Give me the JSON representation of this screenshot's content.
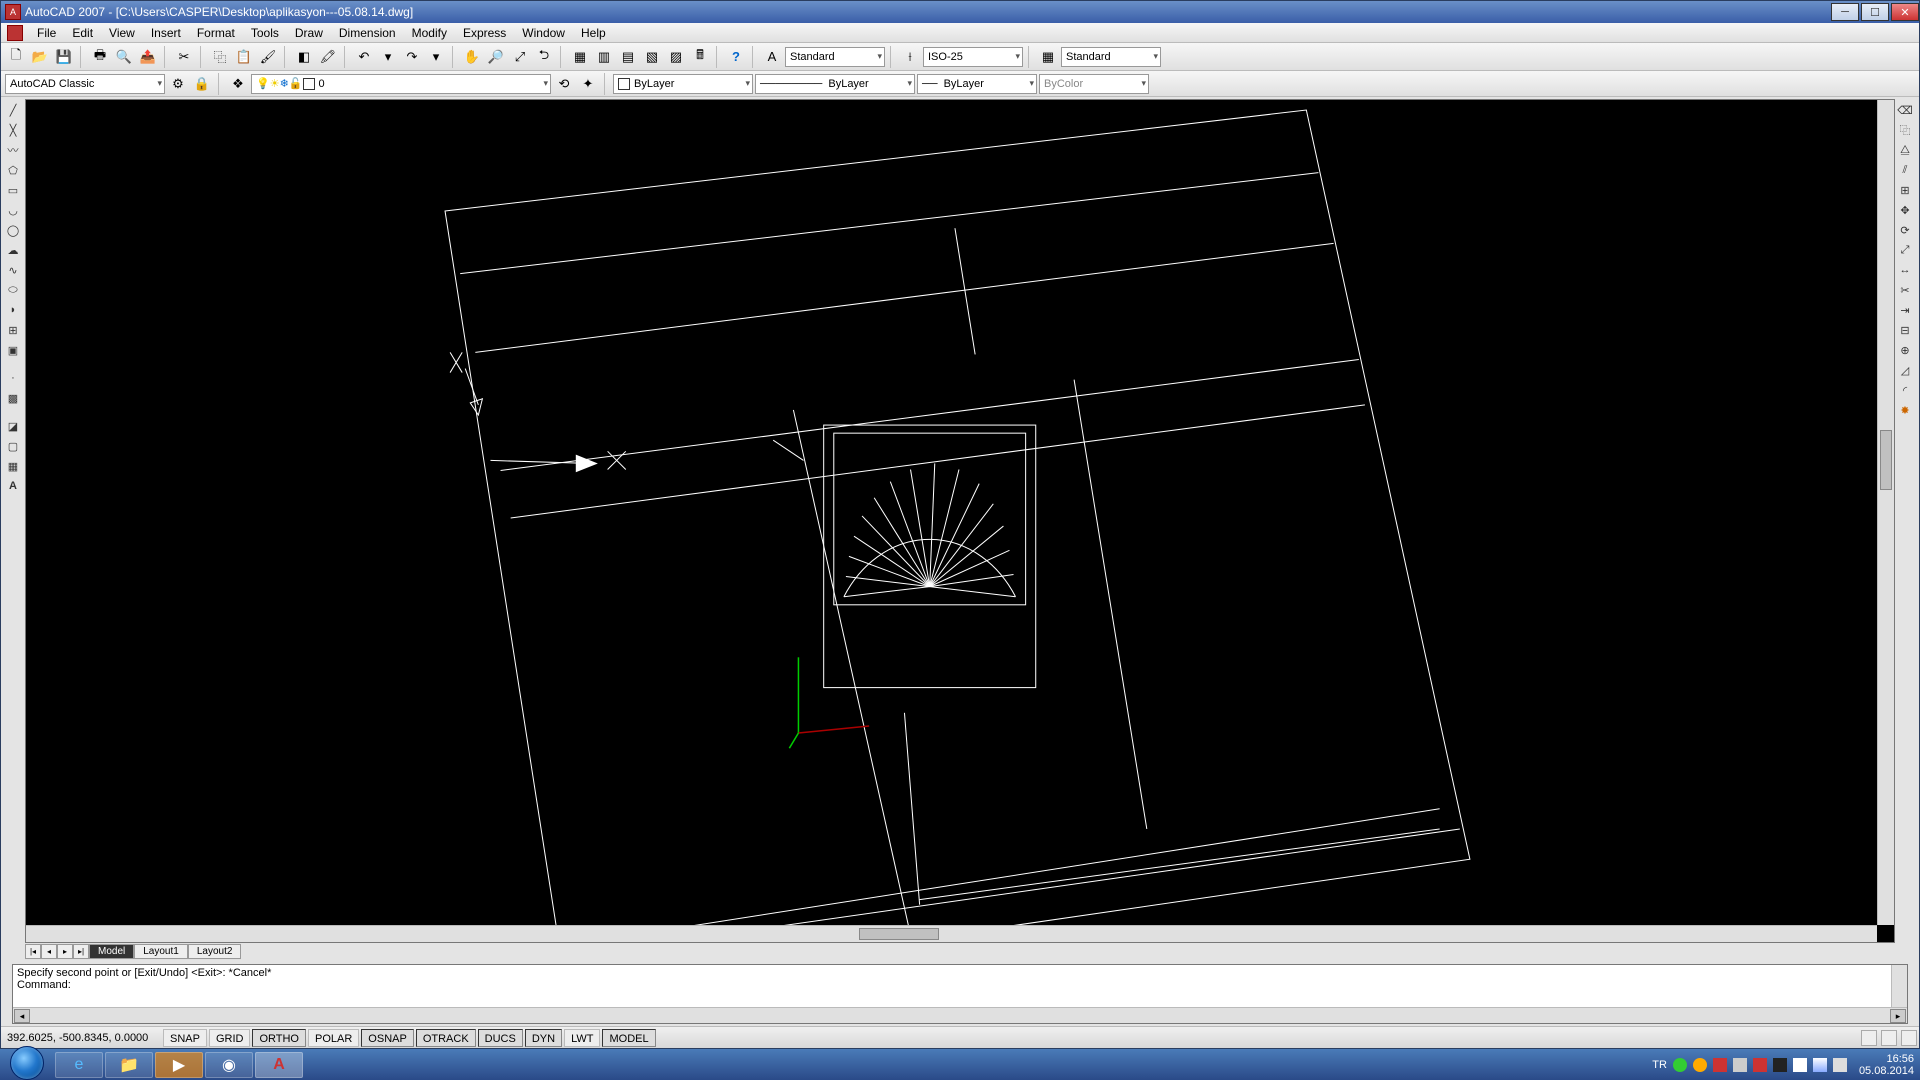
{
  "title": "AutoCAD 2007 - [C:\\Users\\CASPER\\Desktop\\aplikasyon---05.08.14.dwg]",
  "menu": [
    "File",
    "Edit",
    "View",
    "Insert",
    "Format",
    "Tools",
    "Draw",
    "Dimension",
    "Modify",
    "Express",
    "Window",
    "Help"
  ],
  "workspace": "AutoCAD Classic",
  "style1": "Standard",
  "style2": "ISO-25",
  "style3": "Standard",
  "layer": "0",
  "color": "ByLayer",
  "linetype": "ByLayer",
  "lineweight": "ByLayer",
  "plotstyle": "ByColor",
  "tabs": {
    "model": "Model",
    "l1": "Layout1",
    "l2": "Layout2"
  },
  "cmd": {
    "line1": "Specify second point or [Exit/Undo] <Exit>: *Cancel*",
    "line2": "Command:"
  },
  "status": {
    "coords": "392.6025, -500.8345, 0.0000",
    "snap": "SNAP",
    "grid": "GRID",
    "ortho": "ORTHO",
    "polar": "POLAR",
    "osnap": "OSNAP",
    "otrack": "OTRACK",
    "ducs": "DUCS",
    "dyn": "DYN",
    "lwt": "LWT",
    "model": "MODEL"
  },
  "tray": {
    "lang": "TR",
    "time": "16:56",
    "date": "05.08.2014"
  }
}
